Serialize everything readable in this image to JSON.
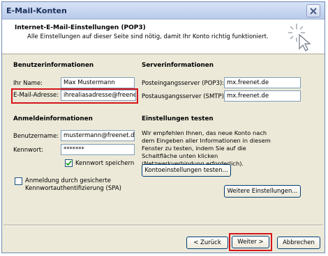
{
  "window": {
    "title": "E-Mail-Konten",
    "close_icon": "close-icon"
  },
  "header": {
    "title": "Internet-E-Mail-Einstellungen (POP3)",
    "subtitle": "Alle Einstellungen auf dieser Seite sind nötig, damit Ihr Konto richtig funktioniert.",
    "icon": "wizard-sparkle-cursor-icon"
  },
  "user_info": {
    "title": "Benutzerinformationen",
    "name_label": "Ihr Name:",
    "name_value": "Max Mustermann",
    "email_label": "E-Mail-Adresse:",
    "email_value": "ihrealiasadresse@freenet.de"
  },
  "server_info": {
    "title": "Serverinformationen",
    "incoming_label": "Posteingangsserver (POP3):",
    "incoming_value": "mx.freenet.de",
    "outgoing_label": "Postausgangsserver (SMTP):",
    "outgoing_value": "mx.freenet.de"
  },
  "login_info": {
    "title": "Anmeldeinformationen",
    "username_label": "Benutzername:",
    "username_value": "mustermann@freenet.de",
    "password_label": "Kennwort:",
    "password_value": "*******",
    "save_password_label": "Kennwort speichern",
    "save_password_checked": true,
    "spa_label_line1": "Anmeldung durch gesicherte",
    "spa_label_line2": "Kennwortauthentifizierung (SPA)",
    "spa_checked": false
  },
  "test_settings": {
    "title": "Einstellungen testen",
    "description": "Wir empfehlen Ihnen, das neue Konto nach dem Eingeben aller Informationen in diesem Fenster zu testen, indem Sie auf die Schaltfläche unten klicken (Netzwerkverbindung erforderlich).",
    "test_button": "Kontoeinstellungen testen...",
    "more_settings_button": "Weitere Einstellungen..."
  },
  "footer": {
    "back_button": "< Zurück",
    "next_button": "Weiter >",
    "cancel_button": "Abbrechen"
  },
  "colors": {
    "highlight": "#d7141a",
    "dialog_bg": "#ece9d8",
    "title_text": "#1a2f5a"
  }
}
